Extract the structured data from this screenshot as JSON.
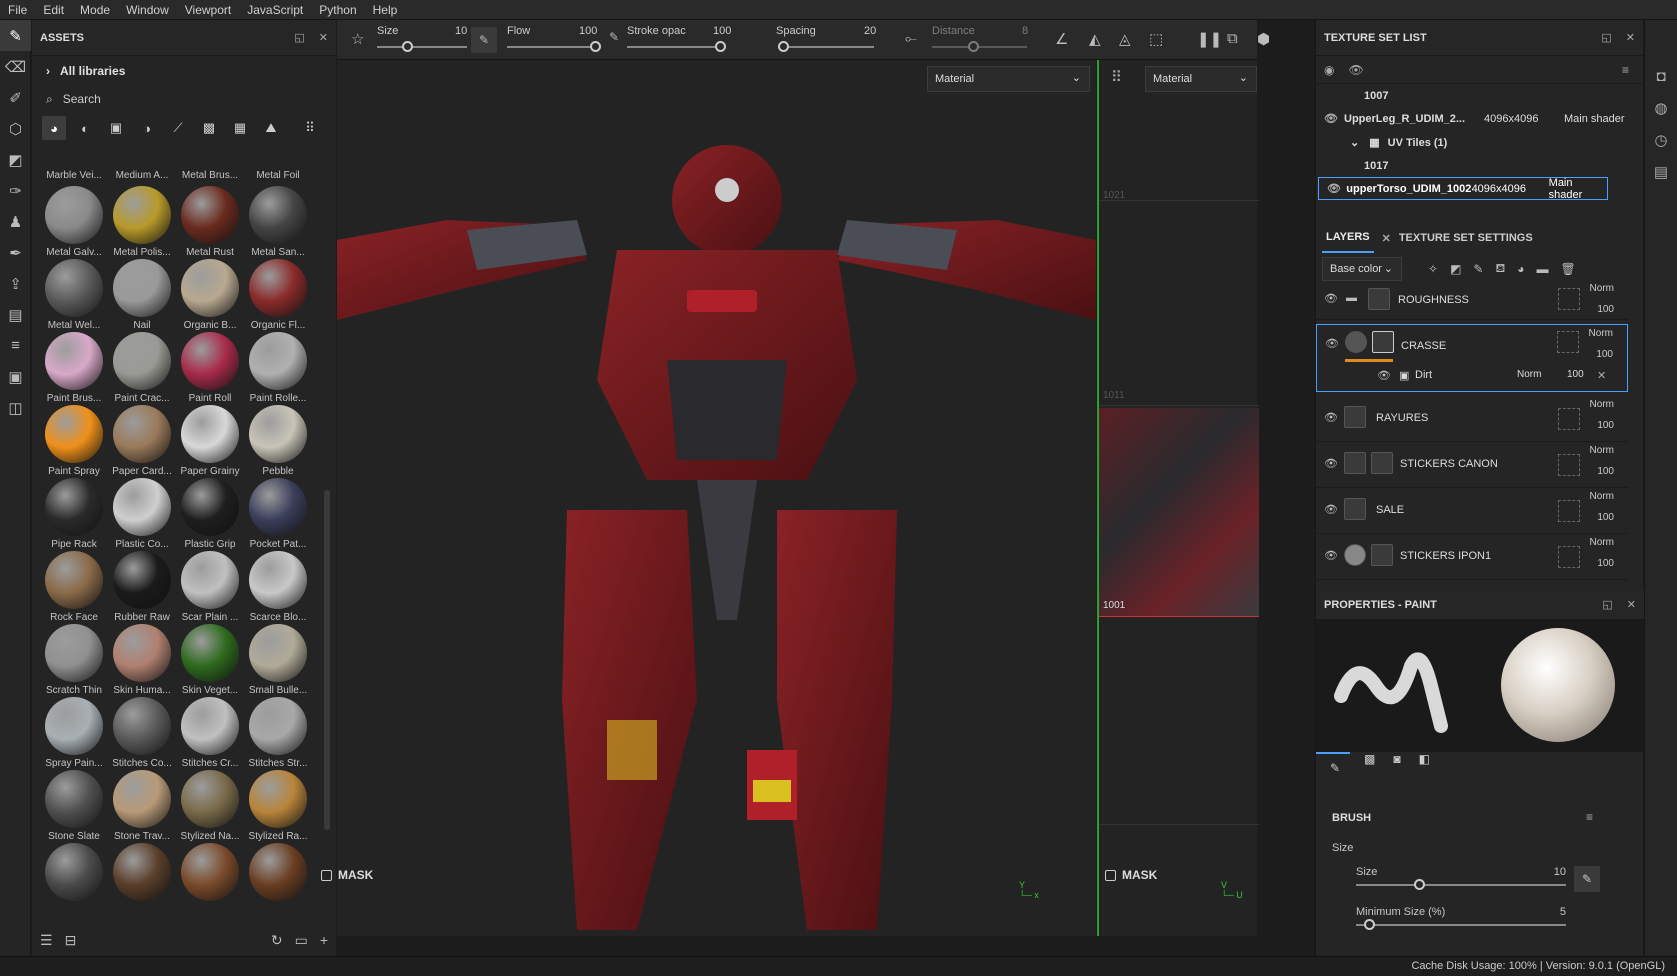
{
  "menu": [
    "File",
    "Edit",
    "Mode",
    "Window",
    "Viewport",
    "JavaScript",
    "Python",
    "Help"
  ],
  "assets": {
    "title": "ASSETS",
    "all_libraries": "All libraries",
    "search_placeholder": "Search",
    "top_row": [
      "Marble Vei...",
      "Medium A...",
      "Metal Brus...",
      "Metal Foil"
    ],
    "items": [
      {
        "name": "Metal Galv...",
        "color": "#8a8a8a"
      },
      {
        "name": "Metal Polis...",
        "color": "#b89a2a"
      },
      {
        "name": "Metal Rust",
        "color": "#6a2a1e"
      },
      {
        "name": "Metal San...",
        "color": "#444444"
      },
      {
        "name": "Metal Wel...",
        "color": "#5a5a5a"
      },
      {
        "name": "Nail",
        "color": "#9a9a9a"
      },
      {
        "name": "Organic B...",
        "color": "#b8a890"
      },
      {
        "name": "Organic Fl...",
        "color": "#8a2a2a"
      },
      {
        "name": "Paint Brus...",
        "color": "#d8a8c8"
      },
      {
        "name": "Paint Crac...",
        "color": "#9a9a95"
      },
      {
        "name": "Paint Roll",
        "color": "#a82a4a"
      },
      {
        "name": "Paint Rolle...",
        "color": "#b0b0b0"
      },
      {
        "name": "Paint Spray",
        "color": "#f0901a"
      },
      {
        "name": "Paper Card...",
        "color": "#9a7a5a"
      },
      {
        "name": "Paper Grainy",
        "color": "#d8d8d8"
      },
      {
        "name": "Pebble",
        "color": "#c8c4b8"
      },
      {
        "name": "Pipe Rack",
        "color": "#2a2a2a"
      },
      {
        "name": "Plastic Co...",
        "color": "#cfcfcf"
      },
      {
        "name": "Plastic Grip",
        "color": "#1e1e1e"
      },
      {
        "name": "Pocket Pat...",
        "color": "#3a3e5a"
      },
      {
        "name": "Rock Face",
        "color": "#8a6a48"
      },
      {
        "name": "Rubber Raw",
        "color": "#1a1a1a"
      },
      {
        "name": "Scar Plain ...",
        "color": "#c0c0c0"
      },
      {
        "name": "Scarce Blo...",
        "color": "#c8c8c8"
      },
      {
        "name": "Scratch Thin",
        "color": "#909090"
      },
      {
        "name": "Skin Huma...",
        "color": "#b08070"
      },
      {
        "name": "Skin Veget...",
        "color": "#2e6a1e"
      },
      {
        "name": "Small Bulle...",
        "color": "#b0aa98"
      },
      {
        "name": "Spray Pain...",
        "color": "#a8b0b4"
      },
      {
        "name": "Stitches Co...",
        "color": "#5a5a5a"
      },
      {
        "name": "Stitches Cr...",
        "color": "#c0c0c0"
      },
      {
        "name": "Stitches Str...",
        "color": "#a8a8a8"
      },
      {
        "name": "Stone Slate",
        "color": "#505050"
      },
      {
        "name": "Stone Trav...",
        "color": "#b89a78"
      },
      {
        "name": "Stylized Na...",
        "color": "#7a6a4a"
      },
      {
        "name": "Stylized Ra...",
        "color": "#b8843a"
      },
      {
        "name": "",
        "color": "#4a4a4a"
      },
      {
        "name": "",
        "color": "#5a3e2a"
      },
      {
        "name": "",
        "color": "#7a4a2a"
      },
      {
        "name": "",
        "color": "#6a3e22"
      }
    ]
  },
  "toolbar": {
    "size_label": "Size",
    "size_value": "10",
    "flow_label": "Flow",
    "flow_value": "100",
    "stroke_label": "Stroke opac",
    "stroke_value": "100",
    "spacing_label": "Spacing",
    "spacing_value": "20",
    "distance_label": "Distance",
    "distance_value": "8"
  },
  "viewport": {
    "material_3d": "Material",
    "material_2d": "Material",
    "mask_label": "MASK",
    "uv_labels": [
      "1021",
      "1011",
      "1001"
    ]
  },
  "texture_set_list": {
    "title": "TEXTURE SET LIST",
    "rows": [
      {
        "name": "1007",
        "res": "",
        "shader": ""
      },
      {
        "name": "UpperLeg_R_UDIM_2...",
        "res": "4096x4096",
        "shader": "Main shader"
      },
      {
        "name": "UV Tiles (1)",
        "res": "",
        "shader": ""
      },
      {
        "name": "1017",
        "res": "",
        "shader": ""
      },
      {
        "name": "upperTorso_UDIM_1002",
        "res": "4096x4096",
        "shader": "Main shader"
      }
    ]
  },
  "layers": {
    "tab_layers": "LAYERS",
    "tab_tss": "TEXTURE SET SETTINGS",
    "channel": "Base color",
    "items": [
      {
        "name": "ROUGHNESS",
        "blend": "Norm",
        "opacity": "100"
      },
      {
        "name": "CRASSE",
        "blend": "Norm",
        "opacity": "100"
      },
      {
        "name": "RAYURES",
        "blend": "Norm",
        "opacity": "100"
      },
      {
        "name": "STICKERS CANON",
        "blend": "Norm",
        "opacity": "100"
      },
      {
        "name": "SALE",
        "blend": "Norm",
        "opacity": "100"
      },
      {
        "name": "STICKERS IPON1",
        "blend": "Norm",
        "opacity": "100"
      }
    ],
    "sub": {
      "name": "Dirt",
      "blend": "Norm",
      "opacity": "100"
    }
  },
  "properties": {
    "title": "PROPERTIES - PAINT",
    "brush": "BRUSH",
    "size_section": "Size",
    "size_label": "Size",
    "size_value": "10",
    "min_size_label": "Minimum Size (%)",
    "min_size_value": "5"
  },
  "status": "Cache Disk Usage: 100% | Version: 9.0.1 (OpenGL)"
}
